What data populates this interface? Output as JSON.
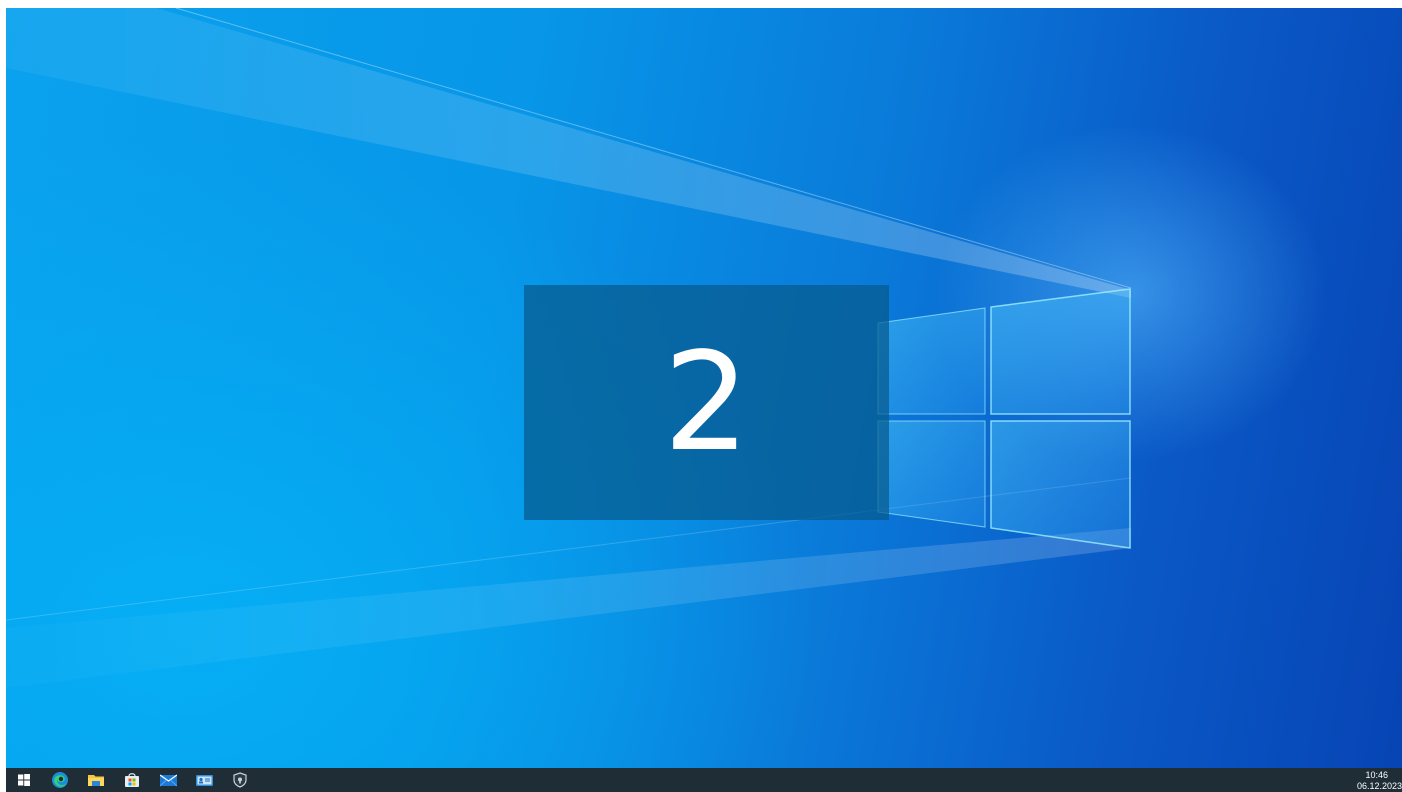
{
  "desktop": {
    "identify_number": "2",
    "colors": {
      "wallpaper_light": "#05aef5",
      "wallpaper_dark": "#0744b4",
      "identify_overlay": "#075a8c",
      "taskbar": "#1f2d36"
    }
  },
  "taskbar": {
    "icons": [
      {
        "name": "start-icon"
      },
      {
        "name": "edge-icon"
      },
      {
        "name": "file-explorer-icon"
      },
      {
        "name": "store-icon"
      },
      {
        "name": "mail-icon"
      },
      {
        "name": "contact-card-icon"
      },
      {
        "name": "security-shield-icon"
      }
    ],
    "clock": {
      "time": "10:46",
      "date": "06.12.2023"
    }
  }
}
